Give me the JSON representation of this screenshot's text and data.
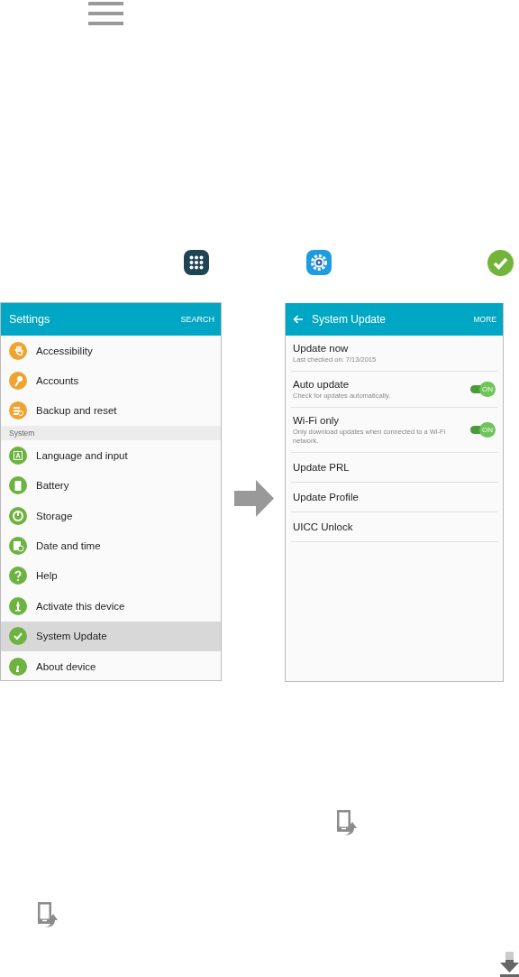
{
  "settings_screen": {
    "title": "Settings",
    "action": "SEARCH",
    "items": [
      {
        "kind": "item",
        "label": "Accessibility",
        "color": "#f0a32f",
        "selected": false
      },
      {
        "kind": "item",
        "label": "Accounts",
        "color": "#f0a32f",
        "selected": false
      },
      {
        "kind": "item",
        "label": "Backup and reset",
        "color": "#f0a32f",
        "selected": false
      },
      {
        "kind": "section",
        "label": "System"
      },
      {
        "kind": "item",
        "label": "Language and input",
        "color": "#6db33f",
        "selected": false
      },
      {
        "kind": "item",
        "label": "Battery",
        "color": "#6db33f",
        "selected": false
      },
      {
        "kind": "item",
        "label": "Storage",
        "color": "#6db33f",
        "selected": false
      },
      {
        "kind": "item",
        "label": "Date and time",
        "color": "#6db33f",
        "selected": false
      },
      {
        "kind": "item",
        "label": "Help",
        "color": "#6db33f",
        "selected": false
      },
      {
        "kind": "item",
        "label": "Activate this device",
        "color": "#6db33f",
        "selected": false
      },
      {
        "kind": "item",
        "label": "System Update",
        "color": "#6db33f",
        "selected": true
      },
      {
        "kind": "item",
        "label": "About device",
        "color": "#6db33f",
        "selected": false
      }
    ]
  },
  "system_update_screen": {
    "title": "System Update",
    "action": "MORE",
    "items": [
      {
        "kind": "plain",
        "label": "Update now",
        "detail": "Last checked on: 7/13/2015"
      },
      {
        "kind": "toggle",
        "label": "Auto update",
        "detail": "Check for updates automatically.",
        "on": true,
        "switch_text": "ON"
      },
      {
        "kind": "toggle",
        "label": "Wi-Fi only",
        "detail": "Only download updates when connected to a Wi-Fi network.",
        "on": true,
        "switch_text": "ON"
      },
      {
        "kind": "plain",
        "label": "Update PRL"
      },
      {
        "kind": "plain",
        "label": "Update Profile"
      },
      {
        "kind": "plain",
        "label": "UICC Unlock"
      }
    ]
  }
}
